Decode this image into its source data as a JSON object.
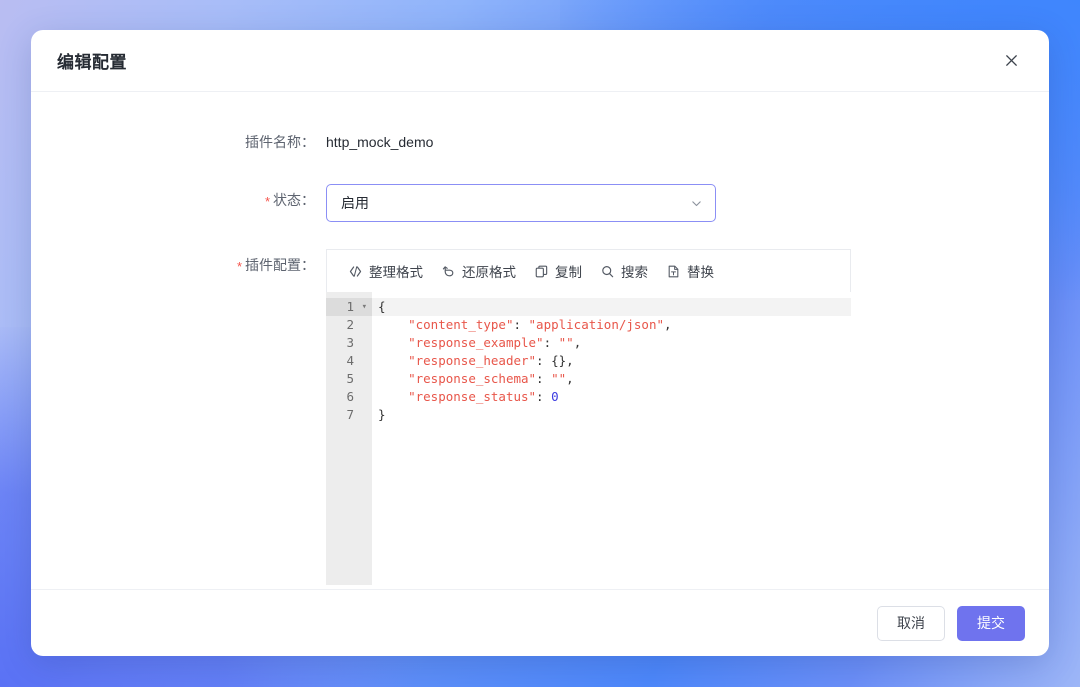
{
  "theme": {
    "accent": "#6f73ee",
    "select_border": "#8b8ff5",
    "required_star": "#f5544c",
    "code_string": "#e8564a",
    "code_number": "#3a3ae0",
    "bg_gradient_from": "#b9bdf2",
    "bg_gradient_to": "#4d88fb"
  },
  "dialog": {
    "title": "编辑配置",
    "close_icon": "close-icon",
    "close_glyph": "✕"
  },
  "form": {
    "plugin_name": {
      "label": "插件名称：",
      "value": "http_mock_demo",
      "required": false
    },
    "status": {
      "label": "状态：",
      "required": true,
      "star": "*",
      "value": "启用",
      "chevron_icon": "chevron-down-icon",
      "options": [
        "启用"
      ]
    },
    "plugin_config": {
      "label": "插件配置：",
      "required": true,
      "star": "*"
    }
  },
  "editor": {
    "toolbar": [
      {
        "label": "整理格式",
        "icon": "code-brackets-icon"
      },
      {
        "label": "还原格式",
        "icon": "undo-arrow-icon"
      },
      {
        "label": "复制",
        "icon": "copy-icon"
      },
      {
        "label": "搜索",
        "icon": "search-icon"
      },
      {
        "label": "替换",
        "icon": "replace-text-icon"
      }
    ],
    "line_numbers": [
      "1",
      "2",
      "3",
      "4",
      "5",
      "6",
      "7"
    ],
    "fold_marker": "▾",
    "active_line": 1,
    "lines": [
      {
        "n": "1",
        "tokens": [
          {
            "t": "punc",
            "v": "{"
          }
        ]
      },
      {
        "n": "2",
        "tokens": [
          {
            "t": "punc",
            "v": "    "
          },
          {
            "t": "key",
            "v": "\"content_type\""
          },
          {
            "t": "punc",
            "v": ": "
          },
          {
            "t": "str",
            "v": "\"application/json\""
          },
          {
            "t": "punc",
            "v": ","
          }
        ]
      },
      {
        "n": "3",
        "tokens": [
          {
            "t": "punc",
            "v": "    "
          },
          {
            "t": "key",
            "v": "\"response_example\""
          },
          {
            "t": "punc",
            "v": ": "
          },
          {
            "t": "str",
            "v": "\"\""
          },
          {
            "t": "punc",
            "v": ","
          }
        ]
      },
      {
        "n": "4",
        "tokens": [
          {
            "t": "punc",
            "v": "    "
          },
          {
            "t": "key",
            "v": "\"response_header\""
          },
          {
            "t": "punc",
            "v": ": "
          },
          {
            "t": "punc",
            "v": "{},"
          }
        ]
      },
      {
        "n": "5",
        "tokens": [
          {
            "t": "punc",
            "v": "    "
          },
          {
            "t": "key",
            "v": "\"response_schema\""
          },
          {
            "t": "punc",
            "v": ": "
          },
          {
            "t": "str",
            "v": "\"\""
          },
          {
            "t": "punc",
            "v": ","
          }
        ]
      },
      {
        "n": "6",
        "tokens": [
          {
            "t": "punc",
            "v": "    "
          },
          {
            "t": "key",
            "v": "\"response_status\""
          },
          {
            "t": "punc",
            "v": ": "
          },
          {
            "t": "num",
            "v": "0"
          }
        ]
      },
      {
        "n": "7",
        "tokens": [
          {
            "t": "punc",
            "v": "}"
          }
        ]
      }
    ],
    "raw_json": "{\n    \"content_type\": \"application/json\",\n    \"response_example\": \"\",\n    \"response_header\": {},\n    \"response_schema\": \"\",\n    \"response_status\": 0\n}"
  },
  "footer": {
    "cancel_label": "取消",
    "submit_label": "提交"
  }
}
